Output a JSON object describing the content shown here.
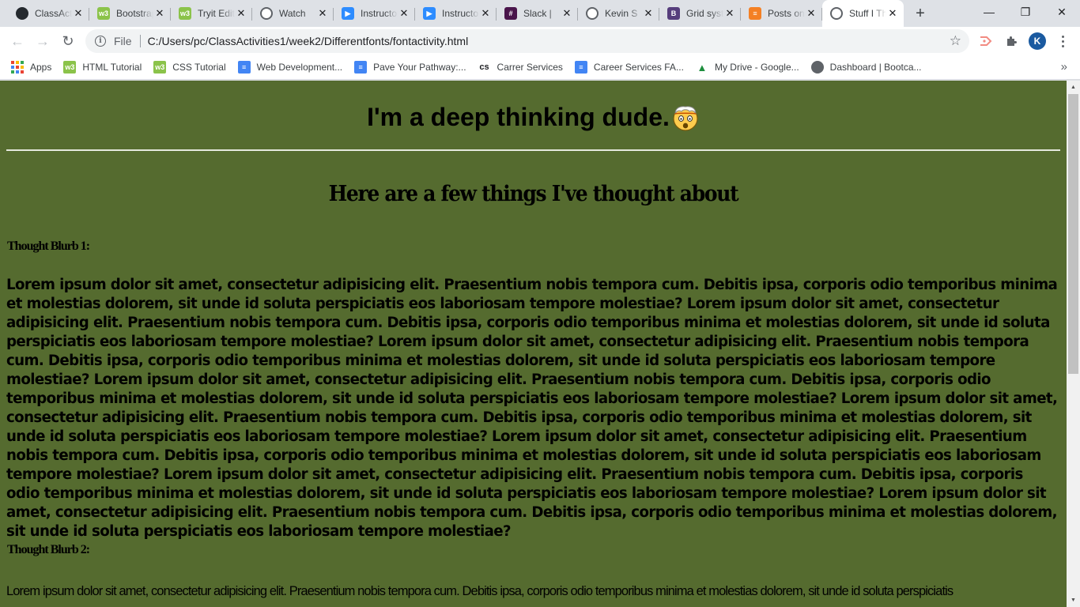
{
  "tabs": [
    {
      "title": "ClassActivities",
      "icon": "github-icon",
      "color": "#24292e"
    },
    {
      "title": "Bootstrap",
      "icon": "w3schools-icon",
      "color": "#8bc34a"
    },
    {
      "title": "Tryit Editor",
      "icon": "w3schools-icon",
      "color": "#8bc34a"
    },
    {
      "title": "Watch",
      "icon": "globe-icon",
      "color": "#5f6368"
    },
    {
      "title": "Instructor",
      "icon": "zoom-icon",
      "color": "#2d8cff"
    },
    {
      "title": "Instructor",
      "icon": "zoom-icon",
      "color": "#2d8cff"
    },
    {
      "title": "Slack | ",
      "icon": "slack-icon",
      "color": "#4a154b"
    },
    {
      "title": "Kevin S",
      "icon": "globe-icon",
      "color": "#5f6368"
    },
    {
      "title": "Grid system",
      "icon": "bootstrap-icon",
      "color": "#563d7c"
    },
    {
      "title": "Posts on",
      "icon": "stackoverflow-icon",
      "color": "#f48024"
    },
    {
      "title": "Stuff I Think",
      "icon": "globe-icon",
      "color": "#5f6368",
      "active": true
    }
  ],
  "window_controls": {
    "minimize": "—",
    "restore": "❐",
    "close": "✕"
  },
  "address_bar": {
    "scheme_label": "File",
    "url": "C:/Users/pc/ClassActivities1/week2/Differentfonts/fontactivity.html"
  },
  "profile_initial": "K",
  "bookmarks": [
    {
      "label": "Apps",
      "icon": "apps-grid-icon"
    },
    {
      "label": "HTML Tutorial",
      "icon": "w3schools-icon"
    },
    {
      "label": "CSS Tutorial",
      "icon": "w3schools-icon"
    },
    {
      "label": "Web Development...",
      "icon": "docs-icon"
    },
    {
      "label": "Pave Your Pathway:...",
      "icon": "docs-icon"
    },
    {
      "label": "Carrer Services",
      "icon": "cs-icon"
    },
    {
      "label": "Career Services FA...",
      "icon": "docs-icon"
    },
    {
      "label": "My Drive - Google...",
      "icon": "google-drive-icon"
    },
    {
      "label": "Dashboard | Bootca...",
      "icon": "globe-icon"
    }
  ],
  "page": {
    "background": "#556b2f",
    "title": "I'm a deep thinking dude.",
    "title_emoji": "exploding-head-icon",
    "subtitle": "Here are a few things I've thought about",
    "blurb1_label": "Thought Blurb 1:",
    "blurb1_text": "Lorem ipsum dolor sit amet, consectetur adipisicing elit. Praesentium nobis tempora cum. Debitis ipsa, corporis odio temporibus minima et molestias dolorem, sit unde id soluta perspiciatis eos laboriosam tempore molestiae? Lorem ipsum dolor sit amet, consectetur adipisicing elit. Praesentium nobis tempora cum. Debitis ipsa, corporis odio temporibus minima et molestias dolorem, sit unde id soluta perspiciatis eos laboriosam tempore molestiae? Lorem ipsum dolor sit amet, consectetur adipisicing elit. Praesentium nobis tempora cum. Debitis ipsa, corporis odio temporibus minima et molestias dolorem, sit unde id soluta perspiciatis eos laboriosam tempore molestiae? Lorem ipsum dolor sit amet, consectetur adipisicing elit. Praesentium nobis tempora cum. Debitis ipsa, corporis odio temporibus minima et molestias dolorem, sit unde id soluta perspiciatis eos laboriosam tempore molestiae? Lorem ipsum dolor sit amet, consectetur adipisicing elit. Praesentium nobis tempora cum. Debitis ipsa, corporis odio temporibus minima et molestias dolorem, sit unde id soluta perspiciatis eos laboriosam tempore molestiae? Lorem ipsum dolor sit amet, consectetur adipisicing elit. Praesentium nobis tempora cum. Debitis ipsa, corporis odio temporibus minima et molestias dolorem, sit unde id soluta perspiciatis eos laboriosam tempore molestiae? Lorem ipsum dolor sit amet, consectetur adipisicing elit. Praesentium nobis tempora cum. Debitis ipsa, corporis odio temporibus minima et molestias dolorem, sit unde id soluta perspiciatis eos laboriosam tempore molestiae? Lorem ipsum dolor sit amet, consectetur adipisicing elit. Praesentium nobis tempora cum. Debitis ipsa, corporis odio temporibus minima et molestias dolorem, sit unde id soluta perspiciatis eos laboriosam tempore molestiae?",
    "blurb2_label": "Thought Blurb 2:",
    "blurb2_text": "Lorem ipsum dolor sit amet, consectetur adipisicing elit. Praesentium nobis tempora cum. Debitis ipsa, corporis odio temporibus minima et molestias dolorem, sit unde id soluta perspiciatis"
  }
}
